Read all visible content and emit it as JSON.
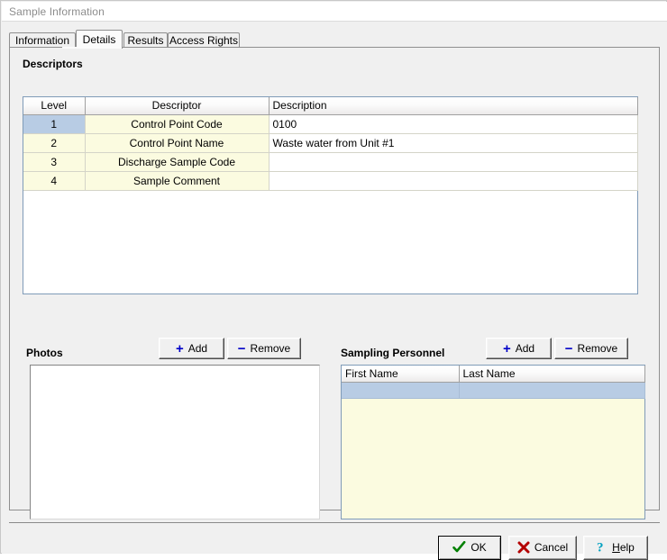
{
  "window": {
    "title": "Sample Information"
  },
  "tabs": [
    {
      "id": "information",
      "label": "Information",
      "active": false
    },
    {
      "id": "details",
      "label": "Details",
      "active": true
    },
    {
      "id": "results",
      "label": "Results",
      "active": false
    },
    {
      "id": "access_rights",
      "label": "Access Rights",
      "active": false
    }
  ],
  "descriptors": {
    "group_label": "Descriptors",
    "columns": [
      "Level",
      "Descriptor",
      "Description"
    ],
    "rows": [
      {
        "level": "1",
        "descriptor": "Control Point Code",
        "description": "0100",
        "selected": true
      },
      {
        "level": "2",
        "descriptor": "Control Point Name",
        "description": "Waste water from Unit #1",
        "selected": false
      },
      {
        "level": "3",
        "descriptor": "Discharge Sample Code",
        "description": "",
        "selected": false
      },
      {
        "level": "4",
        "descriptor": "Sample Comment",
        "description": "",
        "selected": false
      }
    ]
  },
  "photos": {
    "group_label": "Photos",
    "add_label": "Add",
    "remove_label": "Remove",
    "add_glyph": "+",
    "remove_glyph": "−",
    "items": []
  },
  "sampling_personnel": {
    "group_label": "Sampling Personnel",
    "add_label": "Add",
    "remove_label": "Remove",
    "add_glyph": "+",
    "remove_glyph": "−",
    "columns": [
      "First Name",
      "Last Name"
    ],
    "rows": [
      {
        "first_name": "",
        "last_name": "",
        "selected": true
      }
    ]
  },
  "dialog_buttons": {
    "ok": {
      "label": "OK",
      "icon": "check-icon",
      "color": "#008000",
      "default": true
    },
    "cancel": {
      "label": "Cancel",
      "icon": "x-icon",
      "color": "#b40000"
    },
    "help": {
      "label_accel": "H",
      "label_rest": "elp",
      "icon": "question-icon",
      "color": "#00a0c0"
    }
  },
  "colors": {
    "window_background": "#f0f0f0",
    "grid_row_highlight": "#b8cce4",
    "grid_row_cream": "#fbfbe0",
    "grid_border": "#7f9bb8",
    "title_text": "#8d8d8d",
    "toolbar_glyph": "#0000c8"
  }
}
